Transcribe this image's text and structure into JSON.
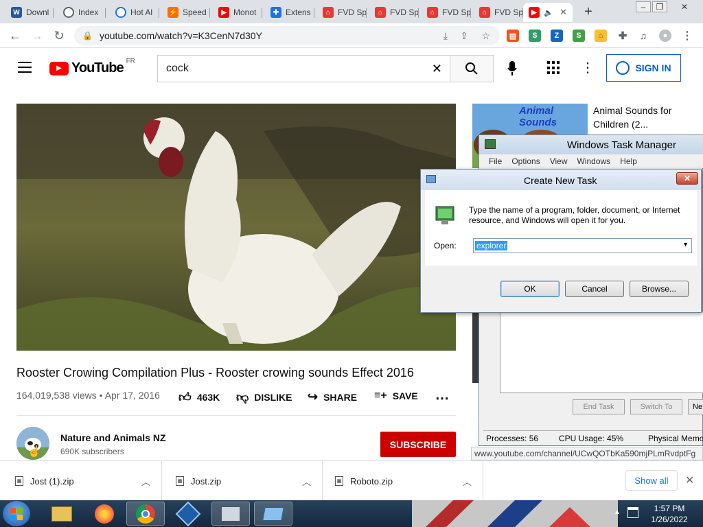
{
  "browser": {
    "tabs": [
      {
        "label": "Downl",
        "icon": "word-doc-icon",
        "color": "#2b579a"
      },
      {
        "label": "Index",
        "icon": "globe-icon",
        "color": "#5f6368"
      },
      {
        "label": "Hot Al",
        "icon": "clock-icon",
        "color": "#1a73e8"
      },
      {
        "label": "Speed",
        "icon": "speed-icon",
        "color": "#ff6d00"
      },
      {
        "label": "Monot",
        "icon": "youtube-icon",
        "color": "#ff0000"
      },
      {
        "label": "Extens",
        "icon": "puzzle-icon",
        "color": "#1a73e8"
      },
      {
        "label": "FVD Sp",
        "icon": "fvd-home-icon",
        "color": "#e53935"
      },
      {
        "label": "FVD Sp",
        "icon": "fvd-home-icon",
        "color": "#e53935"
      },
      {
        "label": "FVD Sp",
        "icon": "fvd-home-icon",
        "color": "#e53935"
      },
      {
        "label": "FVD Sp",
        "icon": "fvd-home-icon",
        "color": "#e53935"
      }
    ],
    "url": "youtube.com/watch?v=K3CenN7d30Y"
  },
  "youtube": {
    "logo_text": "YouTube",
    "country": "FR",
    "search_query": "cock",
    "signin_label": "SIGN IN",
    "video_title": "Rooster Crowing Compilation Plus - Rooster crowing sounds Effect 2016",
    "views": "164,019,538 views",
    "date": "Apr 17, 2016",
    "likes": "463K",
    "dislike_label": "DISLIKE",
    "share_label": "SHARE",
    "save_label": "SAVE",
    "channel_name": "Nature and Animals NZ",
    "subscribers": "690K subscribers",
    "subscribe_label": "SUBSCRIBE",
    "related_thumb_text": "Animal Sounds",
    "related_title": "Animal Sounds for Children (2...",
    "hover_url": "www.youtube.com/channel/UCwQOTbKa590mjPLmRvdptFg"
  },
  "task_manager": {
    "title": "Windows Task Manager",
    "menu": [
      "File",
      "Options",
      "View",
      "Windows",
      "Help"
    ],
    "end_task": "End Task",
    "switch_to": "Switch To",
    "new_task": "Ne",
    "processes": "Processes: 56",
    "cpu": "CPU Usage: 45%",
    "memory": "Physical Memo"
  },
  "dialog": {
    "title": "Create New Task",
    "description": "Type the name of a program, folder, document, or Internet resource, and Windows will open it for you.",
    "open_label": "Open:",
    "open_value": "explorer",
    "ok": "OK",
    "cancel": "Cancel",
    "browse": "Browse..."
  },
  "downloads": {
    "items": [
      "Jost (1).zip",
      "Jost.zip",
      "Roboto.zip"
    ],
    "show_all": "Show all"
  },
  "taskbar": {
    "time": "1:57 PM",
    "date": "1/26/2022"
  },
  "colors": {
    "yt_red": "#ff0000",
    "subscribe_red": "#cc0000",
    "signin_blue": "#065fd4",
    "selection_blue": "#3399ff"
  }
}
